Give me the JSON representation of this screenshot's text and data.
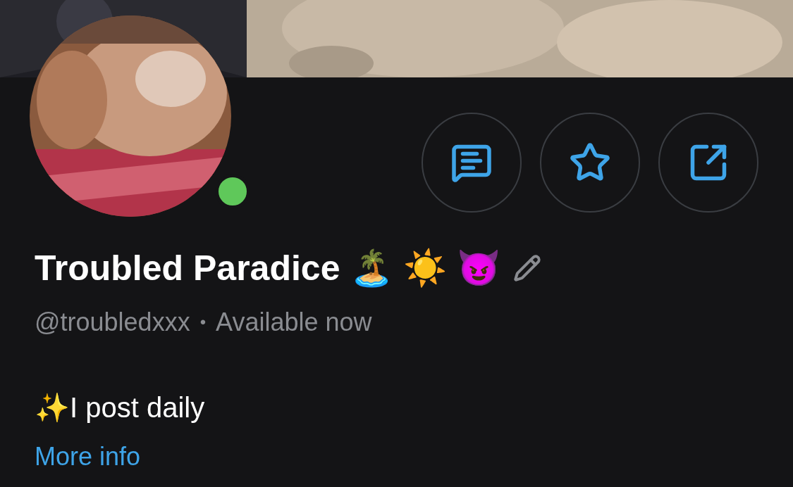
{
  "cover": {
    "kind": "picture"
  },
  "avatar": {
    "kind": "picture",
    "online": true
  },
  "actions": [
    {
      "kind": "message"
    },
    {
      "kind": "star"
    },
    {
      "kind": "share"
    }
  ],
  "profile": {
    "name": "Troubled Paradice 🏝️ ☀️ 😈",
    "editable": true,
    "handle": "@troubledxxx",
    "separator": "•",
    "status": "Available now"
  },
  "bio": "✨I post daily",
  "more_info": "More info"
}
